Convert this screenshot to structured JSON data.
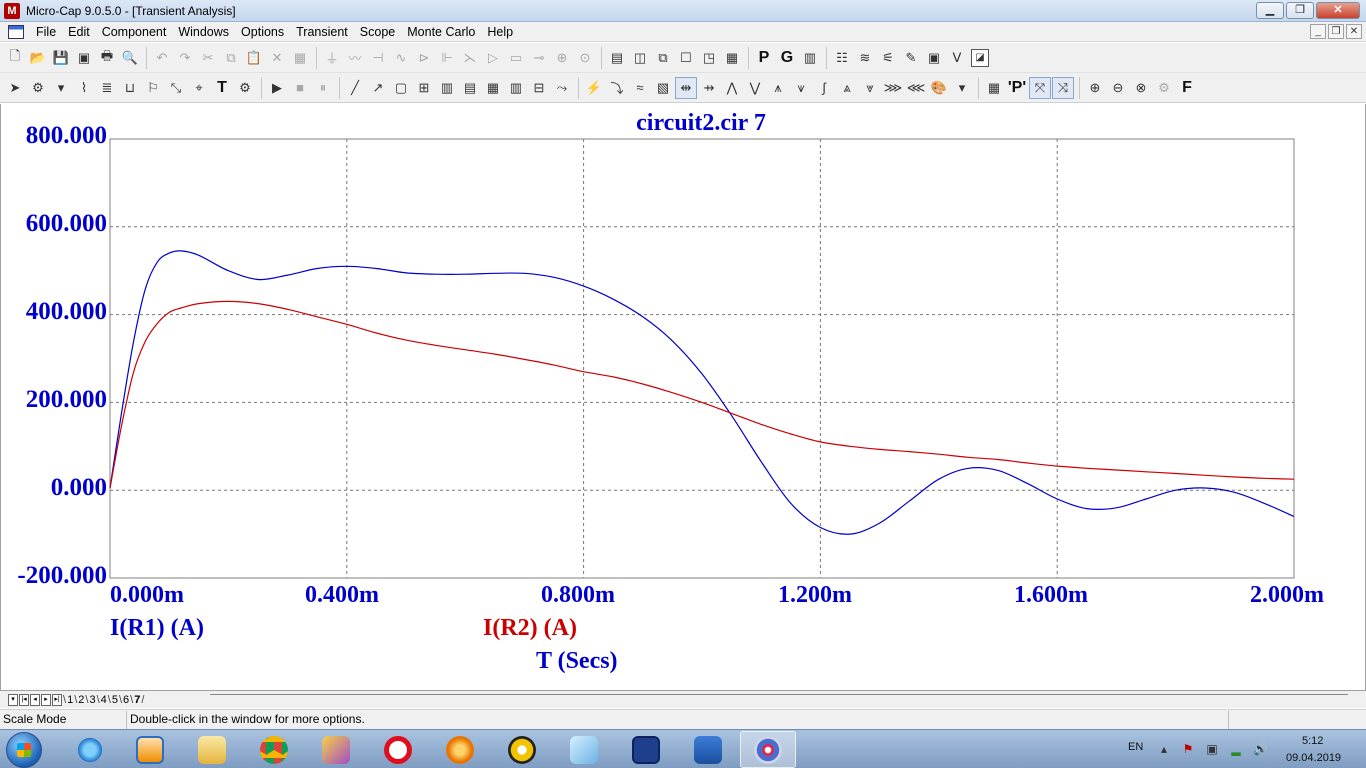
{
  "window": {
    "app_icon_letter": "M",
    "title": "Micro-Cap 9.0.5.0 - [Transient Analysis]",
    "min_label": "▁",
    "max_label": "❐",
    "close_label": "✕"
  },
  "menu": {
    "items": [
      "File",
      "Edit",
      "Component",
      "Windows",
      "Options",
      "Transient",
      "Scope",
      "Monte Carlo",
      "Help"
    ],
    "mdi_min": "_",
    "mdi_restore": "❐",
    "mdi_close": "✕"
  },
  "toolbar1": {
    "p_label": "P",
    "g_label": "G"
  },
  "toolbar2": {
    "text_tool_label": "T",
    "pp_label": "'P'",
    "font_label": "F"
  },
  "chart_data": {
    "type": "line",
    "title": "circuit2.cir 7",
    "xlabel": "T (Secs)",
    "x_ticks": [
      "0.000m",
      "0.400m",
      "0.800m",
      "1.200m",
      "1.600m",
      "2.000m"
    ],
    "y_ticks": [
      "800.000",
      "600.000",
      "400.000",
      "200.000",
      "0.000",
      "-200.000"
    ],
    "xlim": [
      0,
      2.0
    ],
    "ylim": [
      -200,
      800
    ],
    "grid": true,
    "series": [
      {
        "name": "I(R1) (A)",
        "color": "#0000cc",
        "x": [
          0,
          0.02,
          0.04,
          0.06,
          0.08,
          0.1,
          0.12,
          0.15,
          0.2,
          0.25,
          0.3,
          0.35,
          0.4,
          0.45,
          0.5,
          0.55,
          0.6,
          0.65,
          0.7,
          0.75,
          0.8,
          0.85,
          0.9,
          0.95,
          1.0,
          1.05,
          1.1,
          1.15,
          1.2,
          1.25,
          1.3,
          1.35,
          1.4,
          1.45,
          1.5,
          1.55,
          1.6,
          1.65,
          1.7,
          1.75,
          1.8,
          1.85,
          1.9,
          1.95,
          2.0
        ],
        "y": [
          5,
          180,
          340,
          460,
          520,
          540,
          545,
          535,
          500,
          480,
          490,
          505,
          510,
          505,
          495,
          492,
          492,
          494,
          494,
          485,
          465,
          435,
          395,
          340,
          265,
          170,
          65,
          -30,
          -85,
          -100,
          -75,
          -25,
          25,
          50,
          45,
          15,
          -20,
          -42,
          -40,
          -20,
          0,
          5,
          -5,
          -30,
          -60
        ]
      },
      {
        "name": "I(R2) (A)",
        "color": "#cc0000",
        "x": [
          0,
          0.02,
          0.04,
          0.06,
          0.08,
          0.1,
          0.12,
          0.15,
          0.2,
          0.25,
          0.3,
          0.35,
          0.4,
          0.45,
          0.5,
          0.55,
          0.6,
          0.65,
          0.7,
          0.75,
          0.8,
          0.85,
          0.9,
          0.95,
          1.0,
          1.05,
          1.1,
          1.15,
          1.2,
          1.25,
          1.3,
          1.35,
          1.4,
          1.45,
          1.5,
          1.55,
          1.6,
          1.65,
          1.7,
          1.75,
          1.8,
          1.85,
          1.9,
          1.95,
          2.0
        ],
        "y": [
          5,
          150,
          270,
          340,
          380,
          405,
          415,
          425,
          430,
          425,
          412,
          395,
          378,
          358,
          342,
          330,
          320,
          310,
          298,
          285,
          270,
          258,
          242,
          222,
          200,
          175,
          150,
          128,
          110,
          100,
          93,
          88,
          82,
          75,
          70,
          62,
          55,
          50,
          46,
          42,
          38,
          34,
          30,
          27,
          25
        ]
      }
    ]
  },
  "tabs": {
    "items": [
      "1",
      "2",
      "3",
      "4",
      "5",
      "6",
      "7"
    ],
    "active": "7"
  },
  "status": {
    "mode": "Scale Mode",
    "hint": "Double-click in the window for more options."
  },
  "taskbar": {
    "lang": "EN",
    "time": "5:12",
    "date": "09.04.2019"
  }
}
